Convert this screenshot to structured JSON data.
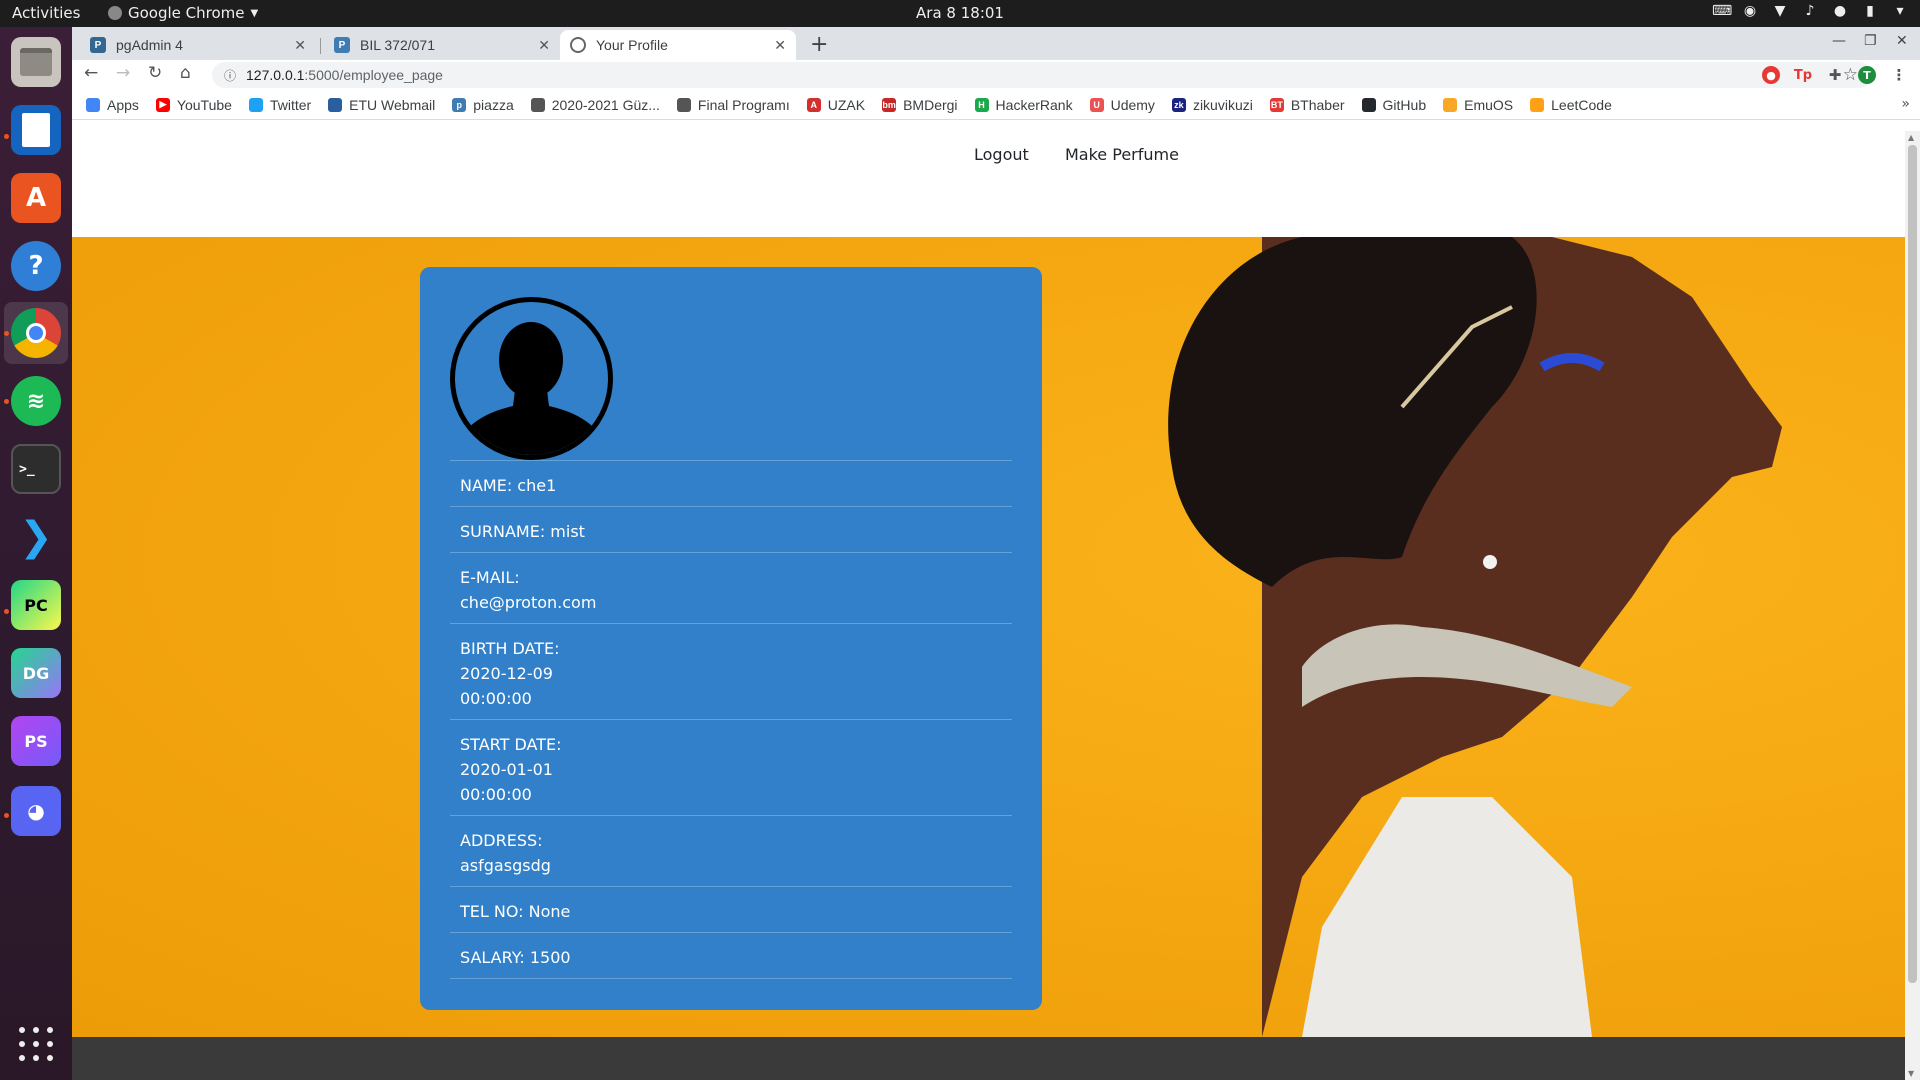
{
  "topbar": {
    "activities": "Activities",
    "app_name": "Google Chrome",
    "clock": "Ara 8  18:01"
  },
  "dock": {
    "items": [
      "files-icon",
      "writer-icon",
      "software-center-icon",
      "help-icon",
      "chrome-icon",
      "spotify-icon",
      "terminal-icon",
      "vscode-icon",
      "pycharm-icon",
      "datagrip-icon",
      "phpstorm-icon",
      "discord-icon"
    ],
    "pycharm_label": "PC",
    "datagrip_label": "DG",
    "phpstorm_label": "PS"
  },
  "tabs": [
    {
      "title": "pgAdmin 4",
      "icon_text": "P"
    },
    {
      "title": "BIL 372/071",
      "icon_text": "P"
    },
    {
      "title": "Your Profile",
      "icon_text": ""
    }
  ],
  "omnibox": {
    "host": "127.0.0.1",
    "path": ":5000/employee_page"
  },
  "profile_avatar_letter": "T",
  "bookmarks": [
    {
      "label": "Apps",
      "color": "#4285f4",
      "icon_text": ""
    },
    {
      "label": "YouTube",
      "color": "#ff0000",
      "icon_text": "▶"
    },
    {
      "label": "Twitter",
      "color": "#1da1f2",
      "icon_text": ""
    },
    {
      "label": "ETU Webmail",
      "color": "#2a5e9e",
      "icon_text": ""
    },
    {
      "label": "piazza",
      "color": "#3e7cb1",
      "icon_text": "p"
    },
    {
      "label": "2020-2021 Güz...",
      "color": "#555555",
      "icon_text": ""
    },
    {
      "label": "Final Programı",
      "color": "#555555",
      "icon_text": ""
    },
    {
      "label": "UZAK",
      "color": "#d32f2f",
      "icon_text": "A"
    },
    {
      "label": "BMDergi",
      "color": "#c62828",
      "icon_text": "bm"
    },
    {
      "label": "HackerRank",
      "color": "#1ba94c",
      "icon_text": "H"
    },
    {
      "label": "Udemy",
      "color": "#ec5252",
      "icon_text": "U"
    },
    {
      "label": "zikuvikuzi",
      "color": "#1a237e",
      "icon_text": "zk"
    },
    {
      "label": "BThaber",
      "color": "#e53935",
      "icon_text": "BT"
    },
    {
      "label": "GitHub",
      "color": "#24292e",
      "icon_text": ""
    },
    {
      "label": "EmuOS",
      "color": "#f9a825",
      "icon_text": ""
    },
    {
      "label": "LeetCode",
      "color": "#ffa116",
      "icon_text": ""
    }
  ],
  "nav": {
    "logout": "Logout",
    "make_perfume": "Make Perfume"
  },
  "profile": {
    "name": "NAME: che1",
    "surname": "SURNAME: mist",
    "email_label": "E-MAIL:",
    "email": "che@proton.com",
    "birth_label": "BIRTH DATE:",
    "birth_date": "2020-12-09",
    "birth_time": "00:00:00",
    "start_label": "START DATE:",
    "start_date": "2020-01-01",
    "start_time": "00:00:00",
    "address_label": "ADDRESS:",
    "address": "asfgasgsdg",
    "tel": "TEL NO: None",
    "salary": "SALARY: 1500"
  },
  "colors": {
    "card": "#3280c9",
    "hero": "#f5a812",
    "footer": "#3a3a3a"
  }
}
